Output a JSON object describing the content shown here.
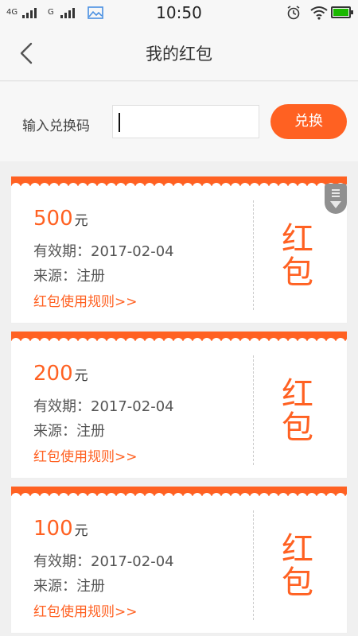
{
  "status_bar": {
    "network_1": "4G",
    "network_2": "G",
    "time": "10:50",
    "battery_color": "#1ab800"
  },
  "header": {
    "title": "我的红包",
    "back_icon": "chevron-left-icon"
  },
  "redeem": {
    "label": "输入兑换码",
    "input_value": "",
    "input_placeholder": "",
    "button_label": "兑换"
  },
  "packets": [
    {
      "amount": "500",
      "unit": "元",
      "validity_label": "有效期：",
      "validity_value": "2017-02-04",
      "source_label": "来源：",
      "source_value": "注册",
      "rules_link": "红包使用规则>>",
      "seal_top": "红",
      "seal_bottom": "包"
    },
    {
      "amount": "200",
      "unit": "元",
      "validity_label": "有效期：",
      "validity_value": "2017-02-04",
      "source_label": "来源：",
      "source_value": "注册",
      "rules_link": "红包使用规则>>",
      "seal_top": "红",
      "seal_bottom": "包"
    },
    {
      "amount": "100",
      "unit": "元",
      "validity_label": "有效期：",
      "validity_value": "2017-02-04",
      "source_label": "来源：",
      "source_value": "注册",
      "rules_link": "红包使用规则>>",
      "seal_top": "红",
      "seal_bottom": "包"
    }
  ],
  "colors": {
    "accent": "#ff6122",
    "background": "#f0f0f0"
  }
}
